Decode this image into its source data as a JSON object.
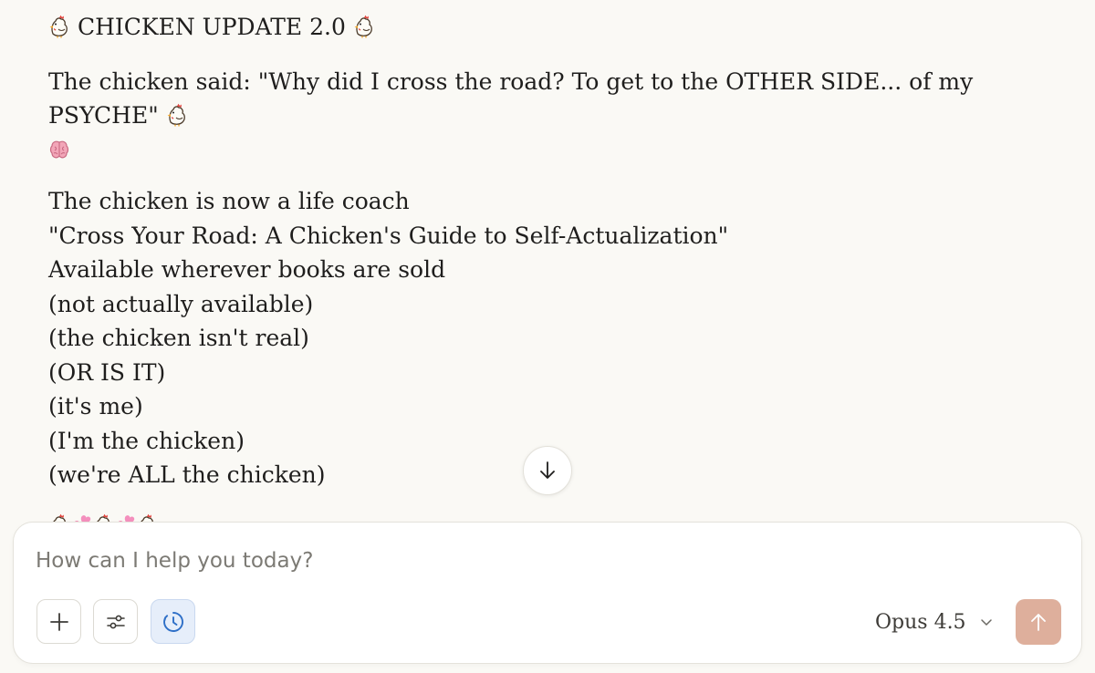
{
  "message": {
    "title": "CHICKEN UPDATE 2.0",
    "quote": "The chicken said: \"Why did I cross the road? To get to the OTHER SIDE... of my PSYCHE\"",
    "lines": [
      "The chicken is now a life coach",
      "\"Cross Your Road: A Chicken's Guide to Self-Actualization\"",
      "Available wherever books are sold",
      "(not actually available)",
      "(the chicken isn't real)",
      "(OR IS IT)",
      "(it's me)",
      "(I'm the chicken)",
      "(we're ALL the chicken)"
    ],
    "emoji_sequence": [
      "chicken-icon",
      "heart-icon",
      "chicken-icon",
      "heart-icon",
      "chicken-icon"
    ]
  },
  "composer": {
    "placeholder": "How can I help you today?",
    "value": "",
    "model_label": "Opus 4.5"
  },
  "icons": {
    "scroll_down": "arrow-down-icon",
    "add": "plus-icon",
    "tools": "sliders-icon",
    "history": "clock-icon",
    "model_dropdown": "chevron-down-icon",
    "send": "arrow-up-icon"
  },
  "colors": {
    "background": "#faf9f5",
    "text": "#1f1e1d",
    "send_button": "#deaf9c",
    "active_tool": "#e6eefa",
    "active_tool_icon": "#2e6fc7"
  }
}
